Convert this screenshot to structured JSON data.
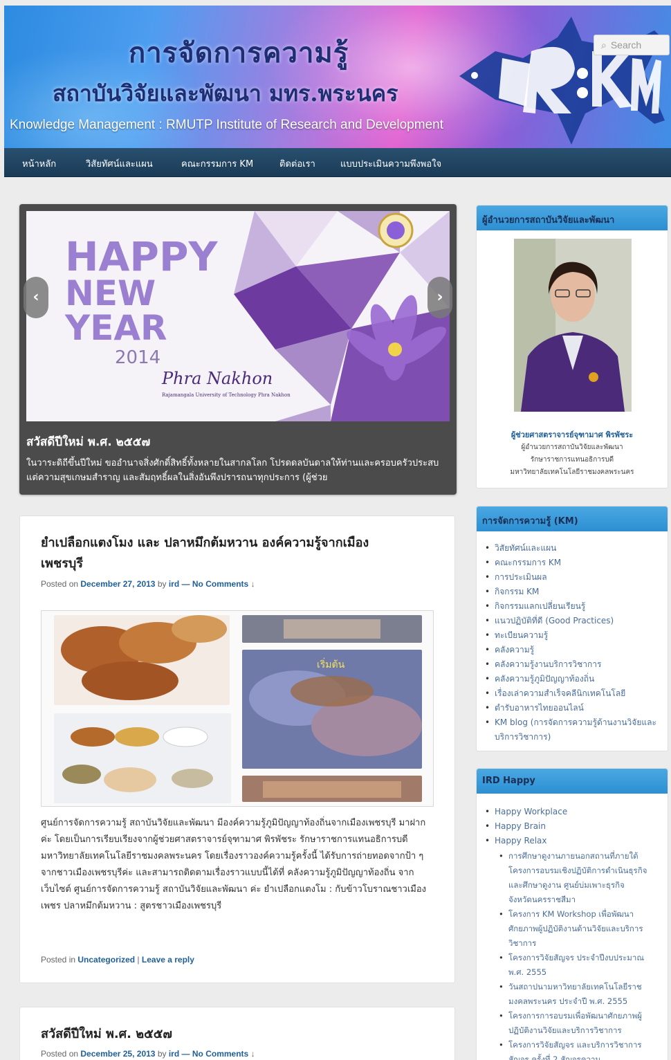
{
  "header": {
    "title": "การจัดการความรู้",
    "subtitle": "สถาบันวิจัยและพัฒนา มทร.พระนคร",
    "description": "Knowledge Management : RMUTP Institute of Research and Development",
    "logo_text": "IRD:KM",
    "search_placeholder": "Search"
  },
  "nav": {
    "items": [
      {
        "label": "หน้าหลัก"
      },
      {
        "label": "วิสัยทัศน์และแผน"
      },
      {
        "label": "คณะกรรมการ KM"
      },
      {
        "label": "ติดต่อเรา"
      },
      {
        "label": "แบบประเมินความพึงพอใจ"
      }
    ]
  },
  "slider": {
    "image_text": {
      "happy": "HAPPY",
      "new": "NEW",
      "year": "YEAR",
      "year_num": "2014",
      "script": "Phra Nakhon",
      "university": "Rajamangala University of Technology Phra Nakhon"
    },
    "caption_title": "สวัสดีปีใหม่ พ.ศ. ๒๕๕๗",
    "caption_text": "ในวาระดิถีขึ้นปีใหม่ ขออำนาจสิ่งศักดิ์สิทธิ์ทั้งหลายในสากลโลก โปรดดลบันดาลให้ท่านและครอบครัวประสบแต่ความสุขเกษมสำราญ และสัมฤทธิ์ผลในสิ่งอันพึงปรารถนาทุกประการ (ผู้ช่วย",
    "prev_icon": "‹",
    "next_icon": "›"
  },
  "article1": {
    "title_line1": "ยำเปลือกแตงโมง และ ปลาหมึกต้มหวาน องค์ความรู้จากเมือง",
    "title_line2": "เพชรบุรี",
    "posted_on": "Posted on",
    "date": "December 27, 2013",
    "by": "by",
    "author": "ird",
    "dash": "—",
    "comments": "No Comments",
    "comments_arrow": "↓",
    "photo_label": "เริ่มต้น",
    "content": "ศูนย์การจัดการความรู้ สถาบันวิจัยและพัฒนา มีองค์ความรู้ภูมิปัญญาท้องถิ่นจากเมืองเพชรบุรี มาฝากค่ะ โดยเป็นการเรียบเรียงจากผู้ช่วยศาสตราจารย์จุฑามาศ พิรพัชระ รักษาราชการแทนอธิการบดี มหาวิทยาลัยเทคโนโลยีราชมงคลพระนคร โดยเรื่องราวองค์ความรู้ครั้งนี้ ได้รับการถ่ายทอดจากป้า ๆ จากชาวเมืองเพชรบุรีค่ะ และสามารถติดตามเรื่องราวแบบนี้ได้ที่ คลังความรู้ภูมิปัญญาท้องถิ่น จากเว็บไซต์ ศูนย์การจัดการความรู้ สถาบันวิจัยและพัฒนา ค่ะ ยำเปลือกแตงโม : กับข้าวโบราณชาวเมืองเพชร ปลาหมึกต้มหวาน : สูตรชาวเมืองเพชรบุรี",
    "posted_in": "Posted in",
    "category": "Uncategorized",
    "sep": "|",
    "leave_reply": "Leave a reply"
  },
  "article2": {
    "title": "สวัสดีปีใหม่ พ.ศ. ๒๕๕๗",
    "posted_on": "Posted on",
    "date": "December 25, 2013",
    "by": "by",
    "author": "ird",
    "dash": "—",
    "comments": "No Comments",
    "comments_arrow": "↓"
  },
  "sidebar": {
    "director": {
      "title": "ผู้อำนวยการสถาบันวิจัยและพัฒนา",
      "name": "ผู้ช่วยศาสตราจารย์จุฑามาศ พิรพัชระ",
      "lines": [
        "ผู้อำนวยการสถาบันวิจัยและพัฒนา",
        "รักษาราชการแทนอธิการบดี",
        "มหาวิทยาลัยเทคโนโลยีราชมงคลพระนคร"
      ]
    },
    "km": {
      "title": "การจัดการความรู้ (KM)",
      "items": [
        "วิสัยทัศน์และแผน",
        "คณะกรรมการ KM",
        "การประเมินผล",
        "กิจกรรม KM",
        "กิจกรรมแลกเปลี่ยนเรียนรู้",
        "แนวปฏิบัติที่ดี (Good Practices)",
        "ทะเบียนความรู้",
        "คลังความรู้",
        "คลังความรู้งานบริการวิชาการ",
        "คลังความรู้ภูมิปัญญาท้องถิ่น",
        "เรื่องเล่าความสำเร็จคลีนิกเทคโนโลยี",
        "ตำรับอาหารไทยออนไลน์",
        "KM blog (การจัดการความรู้ด้านงานวิจัยและ",
        "บริการวิชาการ)"
      ]
    },
    "happy": {
      "title": "IRD Happy",
      "items": [
        "Happy Workplace",
        "Happy Brain",
        "Happy Relax"
      ],
      "subitems": [
        [
          "การศึกษาดูงานภายนอกสถานที่ภายใต้",
          "โครงการอบรมเชิงปฏิบัติการดำเนินธุรกิจ",
          "และศึกษาดูงาน ศูนย์บ่มเพาะธุรกิจ",
          "จังหวัดนครราชสีมา"
        ],
        [
          "โครงการ KM Workshop เพื่อพัฒนา",
          "ศักยภาพผู้ปฏิบัติงานด้านวิจัยและบริการ",
          "วิชาการ"
        ],
        [
          "โครงการวิจัยสัญจร ประจำปีงบประมาณ",
          "พ.ศ. 2555"
        ],
        [
          "วันสถาปนามหาวิทยาลัยเทคโนโลยีราช",
          "มงคลพระนคร ประจำปี พ.ศ. 2555"
        ],
        [
          "โครงการการอบรมเพื่อพัฒนาศักยภาพผู้",
          "ปฏิบัติงานวิจัยและบริการวิชาการ"
        ],
        [
          "โครงการวิจัยสัญจร และบริการวิชาการ",
          "สัญจร ครั้งที่ 2 สัญจรความ"
        ]
      ]
    }
  },
  "colors": {
    "nav_bg": "#1f4563",
    "widget_header": "#3a9bd9",
    "link": "#1e5f9a",
    "slider_bg": "#4b4b4b"
  }
}
